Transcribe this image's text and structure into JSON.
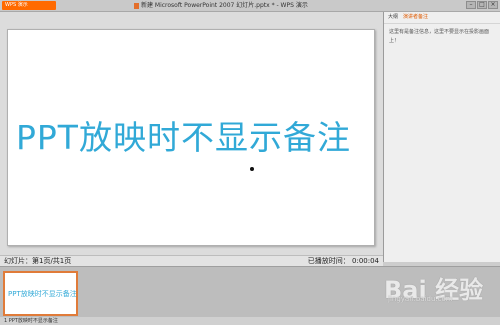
{
  "titlebar": {
    "app_label": "WPS 演示",
    "doc_title": "新建 Microsoft PowerPoint 2007 幻灯片.pptx * - WPS 演示"
  },
  "slide": {
    "main_text": "PPT放映时不显示备注"
  },
  "right_panel": {
    "tab_outline": "大纲",
    "tab_notes": "演讲者备注",
    "notes_text": "这里有是备注信息，这里不要显示在投影画面上！"
  },
  "statusbar": {
    "slide_info": "幻灯片：第1页/共1页",
    "elapsed": "已播放时间： 0:00:04"
  },
  "thumbnail": {
    "text": "PPT放映时不显示备注"
  },
  "bottombar": {
    "text": "1 PPT放映时不显示备注"
  },
  "watermark": {
    "logo": "Bai 经验",
    "url": "jingyan.baidu.com"
  },
  "colors": {
    "accent": "#ff6a00",
    "slide_text": "#31a9d7"
  }
}
